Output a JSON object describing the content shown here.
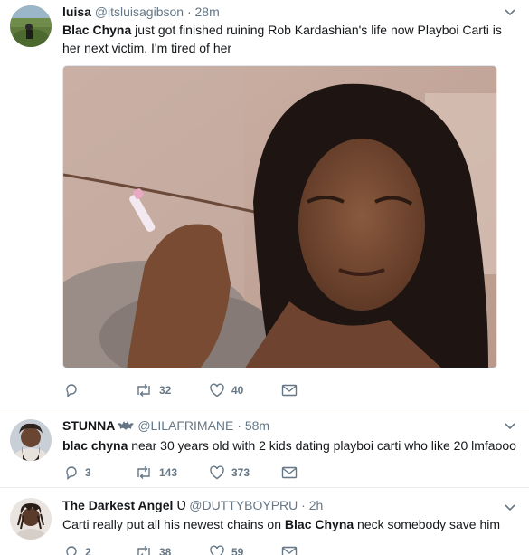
{
  "tweets": [
    {
      "name": "luisa",
      "handle": "@itsluisagibson",
      "separator": "·",
      "time": "28m",
      "text_bold": "Blac Chyna",
      "text_rest": " just got finished ruining Rob Kardashian's life now Playboi Carti is her next victim. I'm tired of her",
      "replies": "",
      "retweets": "32",
      "likes": "40",
      "avatar_icon": "avatar-photo",
      "media_icon": "attached-photo"
    },
    {
      "name": "STUNNA",
      "name_badge_icon": "verified-like-badge-icon",
      "handle": "@LILAFRIMANE",
      "separator": "·",
      "time": "58m",
      "text_bold": "blac chyna",
      "text_rest": " near 30 years old with 2 kids dating playboi carti who like 20 lmfaooo",
      "replies": "3",
      "retweets": "143",
      "likes": "373",
      "avatar_icon": "avatar-photo"
    },
    {
      "name": "The Darkest Angel",
      "name_glyph": "Ʋ",
      "handle": "@DUTTYBOYPRU",
      "separator": "·",
      "time": "2h",
      "text_pre": "Carti really put all his newest chains on ",
      "text_bold": "Blac Chyna",
      "text_rest": " neck somebody save him",
      "replies": "2",
      "retweets": "38",
      "likes": "59",
      "avatar_icon": "avatar-photo"
    }
  ],
  "colors": {
    "text": "#14171a",
    "muted": "#657786",
    "divider": "#e6ecf0"
  }
}
